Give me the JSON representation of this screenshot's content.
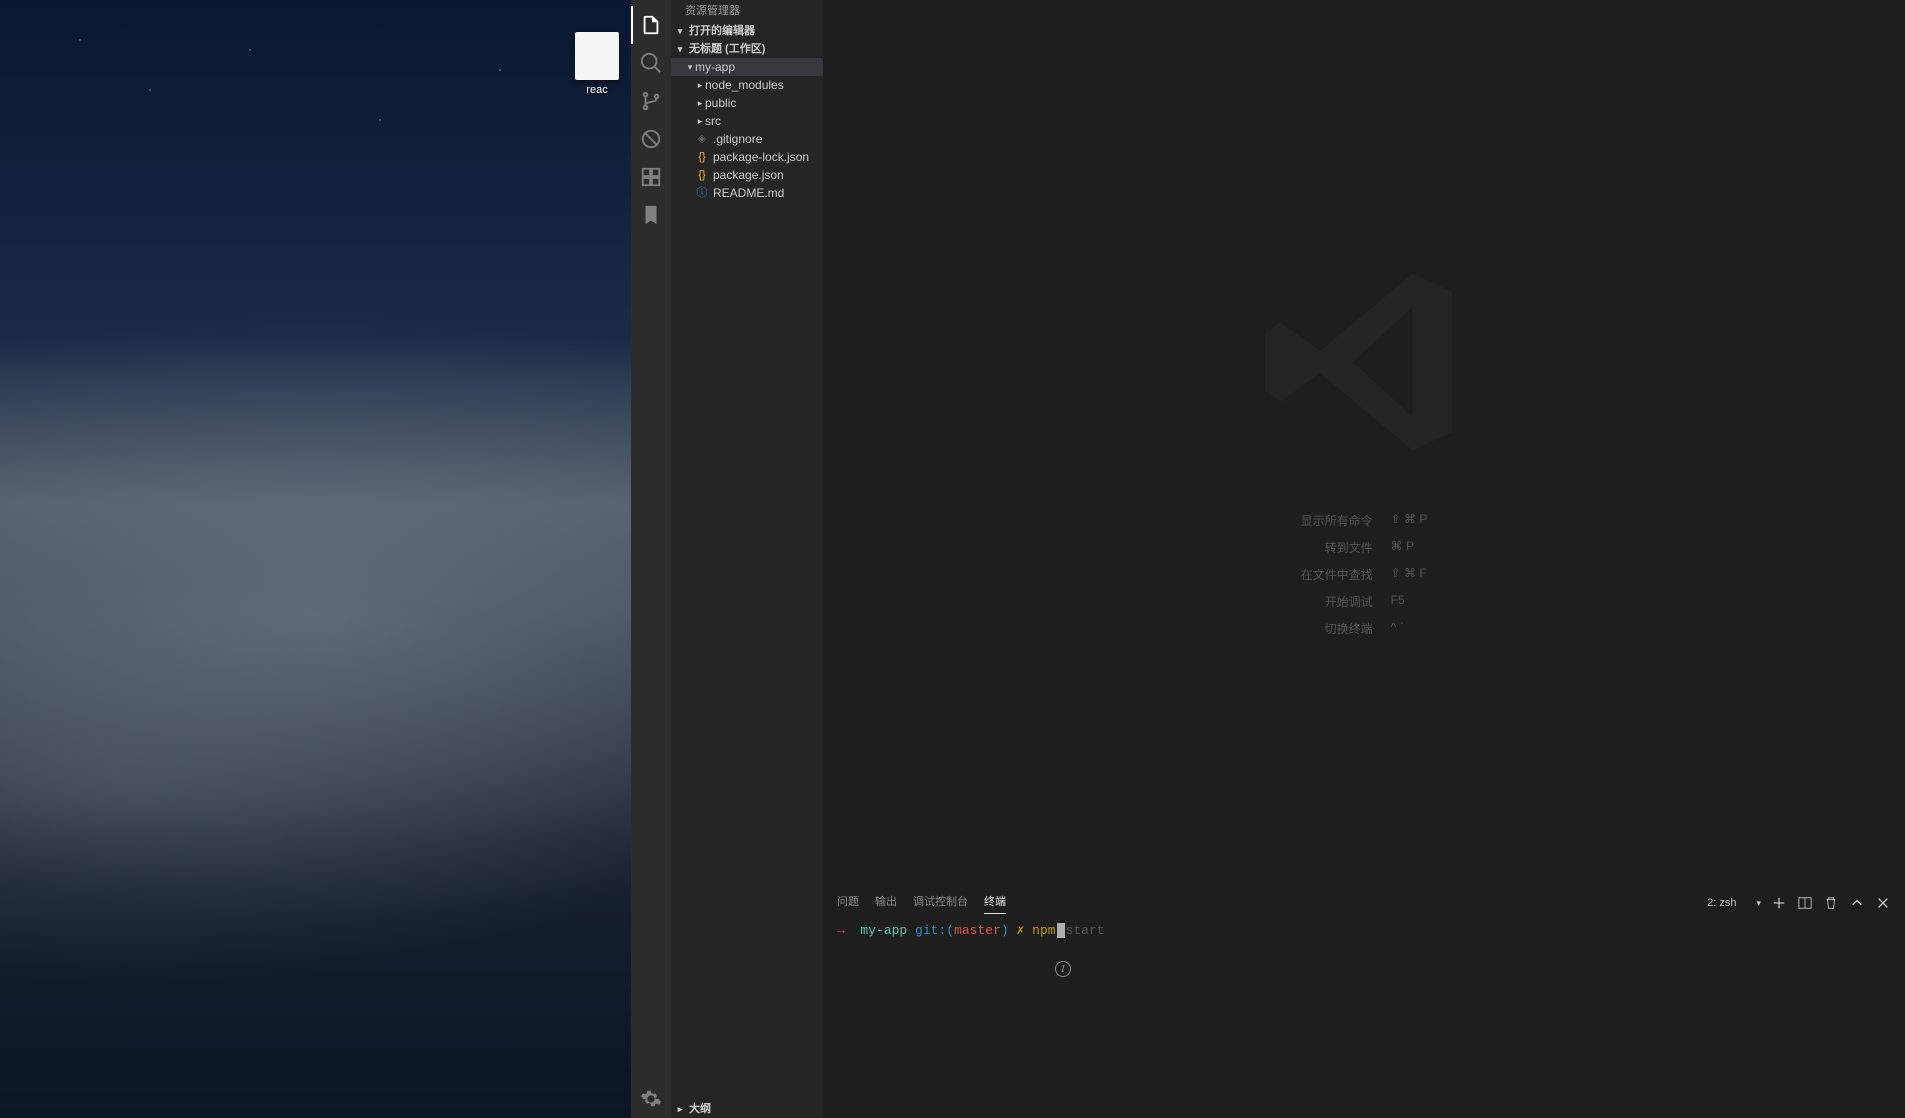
{
  "desktop": {
    "icon_label": "reac"
  },
  "sidebar": {
    "title": "资源管理器",
    "open_editors": "打开的编辑器",
    "workspace": "无标题 (工作区)",
    "tree": {
      "project": "my-app",
      "nodes": [
        {
          "name": "node_modules",
          "type": "folder"
        },
        {
          "name": "public",
          "type": "folder"
        },
        {
          "name": "src",
          "type": "folder"
        },
        {
          "name": ".gitignore",
          "type": "gitignore"
        },
        {
          "name": "package-lock.json",
          "type": "json"
        },
        {
          "name": "package.json",
          "type": "json"
        },
        {
          "name": "README.md",
          "type": "info"
        }
      ]
    },
    "outline": "大纲"
  },
  "welcome": {
    "hints": [
      {
        "label": "显示所有命令",
        "key": "⇧ ⌘ P"
      },
      {
        "label": "转到文件",
        "key": "⌘ P"
      },
      {
        "label": "在文件中查找",
        "key": "⇧ ⌘ F"
      },
      {
        "label": "开始调试",
        "key": "F5"
      },
      {
        "label": "切换终端",
        "key": "^ `"
      }
    ]
  },
  "panel": {
    "tabs": {
      "problems": "问题",
      "output": "输出",
      "debug": "调试控制台",
      "terminal": "终端"
    },
    "terminal_select": "2: zsh",
    "prompt": {
      "arrow": "→",
      "dir": "my-app",
      "git_label": "git:",
      "paren_open": "(",
      "branch": "master",
      "paren_close": ")",
      "x": "✗",
      "typed": "npm",
      "suggestion": "start"
    }
  }
}
